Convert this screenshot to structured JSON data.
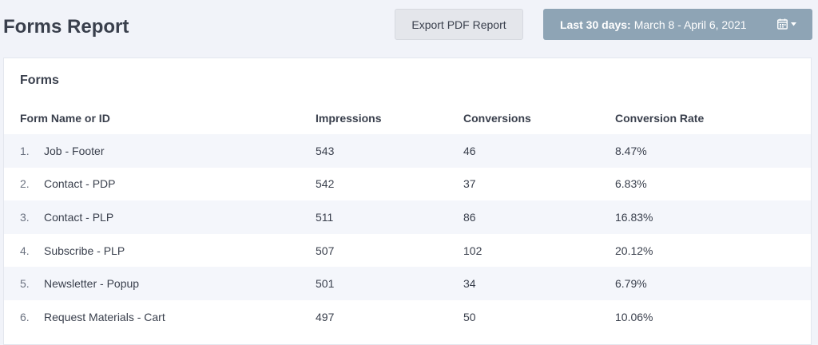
{
  "header": {
    "title": "Forms Report",
    "export_label": "Export PDF Report",
    "date_label": "Last 30 days:",
    "date_range": "March 8 - April 6, 2021",
    "calendar_icon": "calendar-icon",
    "dropdown_icon": "caret-down-icon"
  },
  "card": {
    "title": "Forms",
    "columns": [
      "Form Name or ID",
      "Impressions",
      "Conversions",
      "Conversion Rate"
    ],
    "rows": [
      {
        "num": "1.",
        "name": "Job - Footer",
        "impressions": "543",
        "conversions": "46",
        "rate": "8.47%"
      },
      {
        "num": "2.",
        "name": "Contact - PDP",
        "impressions": "542",
        "conversions": "37",
        "rate": "6.83%"
      },
      {
        "num": "3.",
        "name": "Contact - PLP",
        "impressions": "511",
        "conversions": "86",
        "rate": "16.83%"
      },
      {
        "num": "4.",
        "name": "Subscribe - PLP",
        "impressions": "507",
        "conversions": "102",
        "rate": "20.12%"
      },
      {
        "num": "5.",
        "name": "Newsletter - Popup",
        "impressions": "501",
        "conversions": "34",
        "rate": "6.79%"
      },
      {
        "num": "6.",
        "name": "Request Materials - Cart",
        "impressions": "497",
        "conversions": "50",
        "rate": "10.06%"
      }
    ]
  },
  "colors": {
    "background": "#f1f3f9",
    "date_button": "#8ea4b5",
    "row_stripe": "#f4f6fb"
  }
}
